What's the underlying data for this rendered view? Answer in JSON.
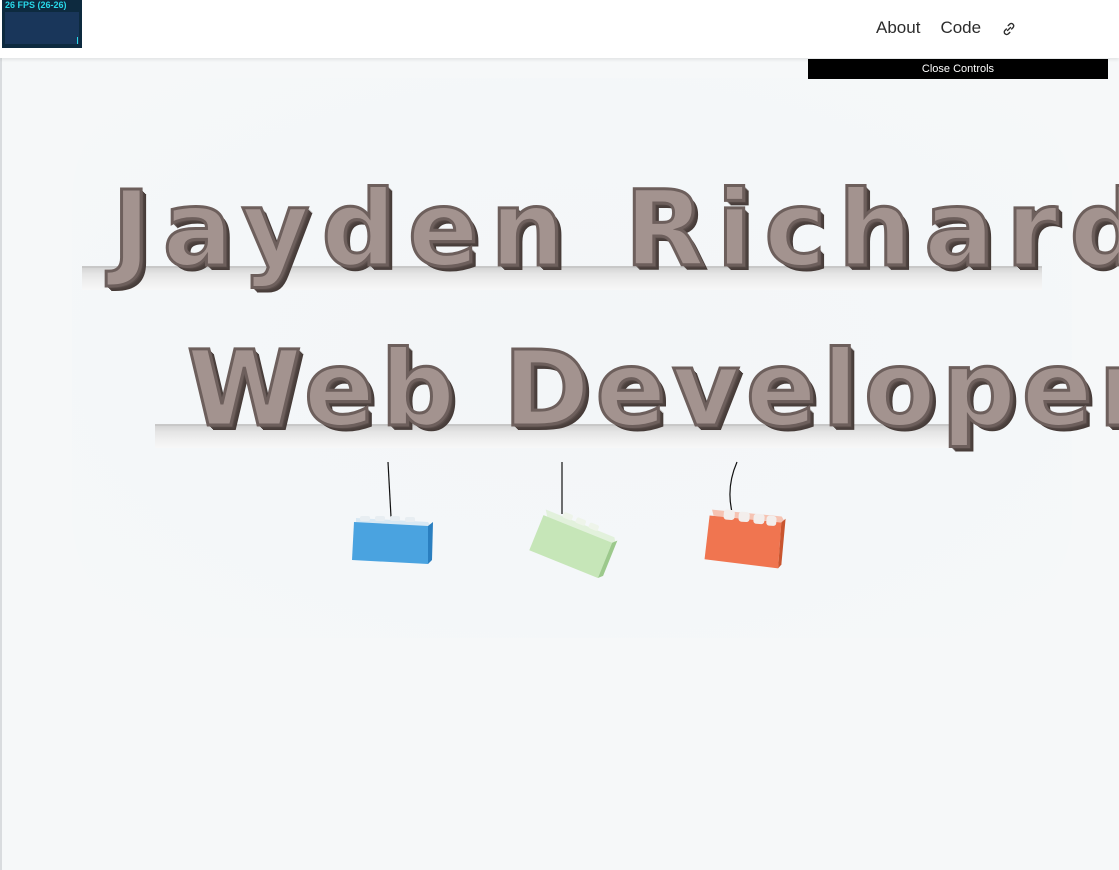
{
  "fps_meter": {
    "label": "26 FPS (26-26)",
    "fps": 26,
    "min": 26,
    "max": 26
  },
  "nav": {
    "about_label": "About",
    "code_label": "Code",
    "link_icon": "external-link-icon"
  },
  "controls": {
    "close_label": "Close Controls"
  },
  "scene": {
    "title_name": "Jayden Richardson",
    "title_role": "Web Developer",
    "blocks": [
      {
        "name": "blue-block",
        "color": "#4aa3e0"
      },
      {
        "name": "green-block",
        "color": "#c6e6b8"
      },
      {
        "name": "orange-block",
        "color": "#f07550"
      }
    ]
  }
}
